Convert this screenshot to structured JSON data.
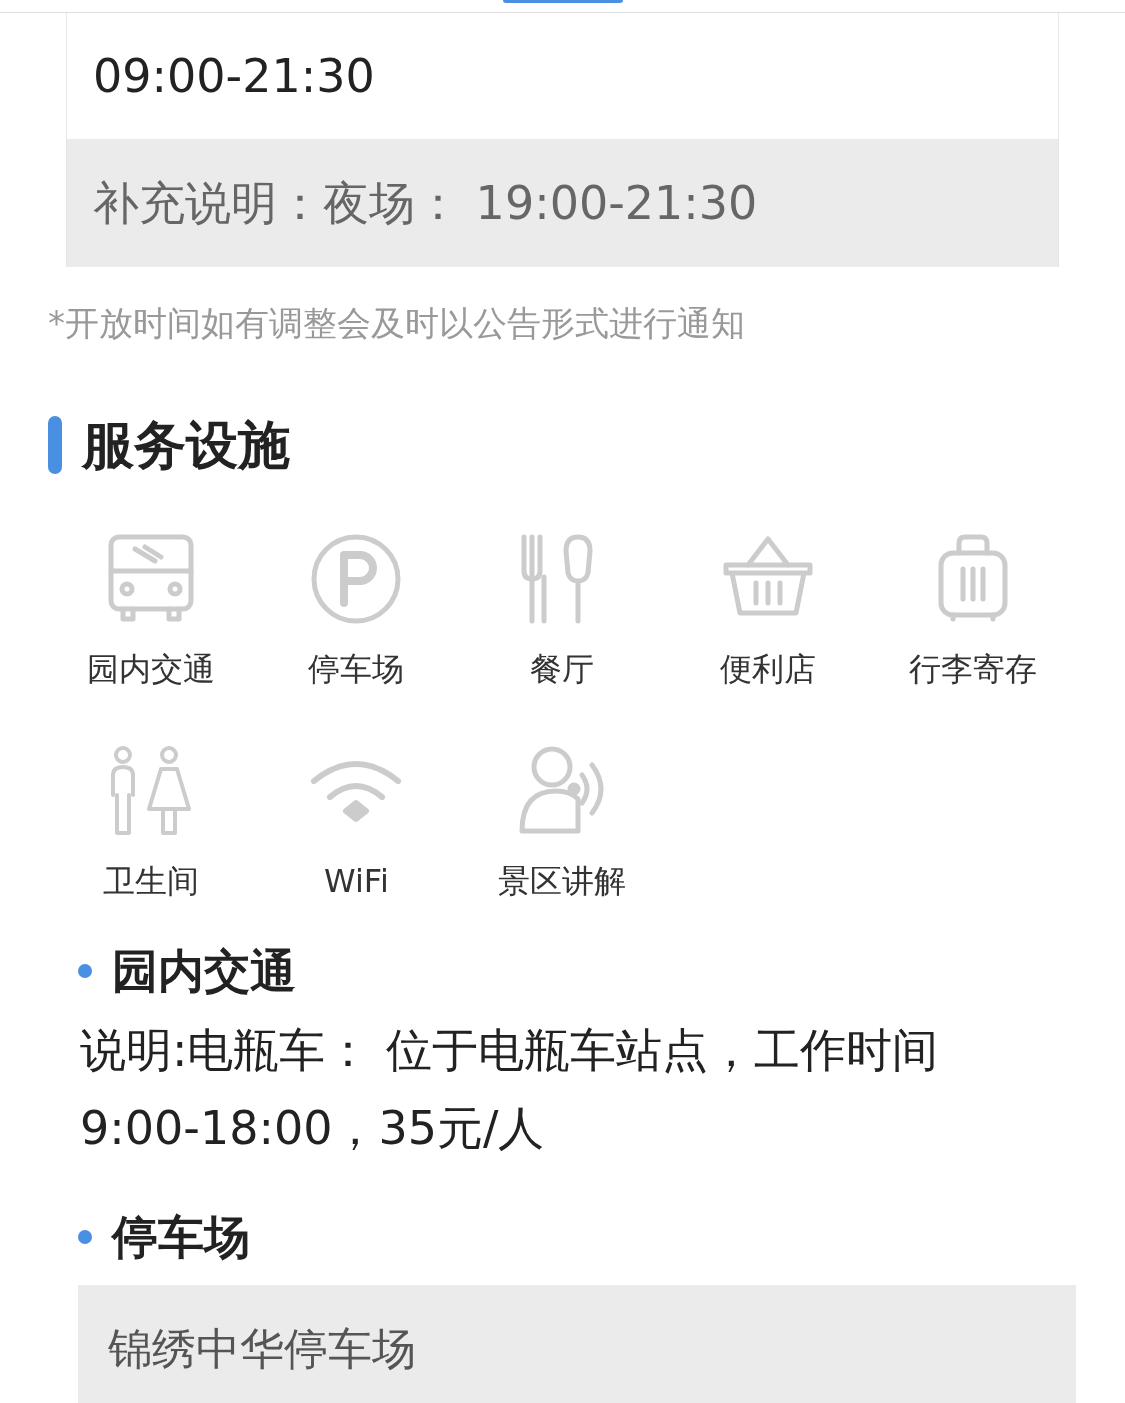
{
  "hours": {
    "time": "09:00-21:30",
    "note": "补充说明：夜场： 19:00-21:30"
  },
  "notice": "*开放时间如有调整会及时以公告形式进行通知",
  "section_title": "服务设施",
  "facilities": [
    {
      "kind": "bus",
      "label": "园内交通"
    },
    {
      "kind": "parking",
      "label": "停车场"
    },
    {
      "kind": "restaurant",
      "label": "餐厅"
    },
    {
      "kind": "shop",
      "label": "便利店"
    },
    {
      "kind": "luggage",
      "label": "行李寄存"
    },
    {
      "kind": "toilet",
      "label": "卫生间"
    },
    {
      "kind": "wifi",
      "label": "WiFi"
    },
    {
      "kind": "guide",
      "label": "景区讲解"
    }
  ],
  "details": [
    {
      "kind": "text",
      "title": "园内交通",
      "text": "说明:电瓶车： 位于电瓶车站点，工作时间9:00-18:00，35元/人"
    },
    {
      "kind": "box",
      "title": "停车场",
      "text": "锦绣中华停车场"
    }
  ]
}
